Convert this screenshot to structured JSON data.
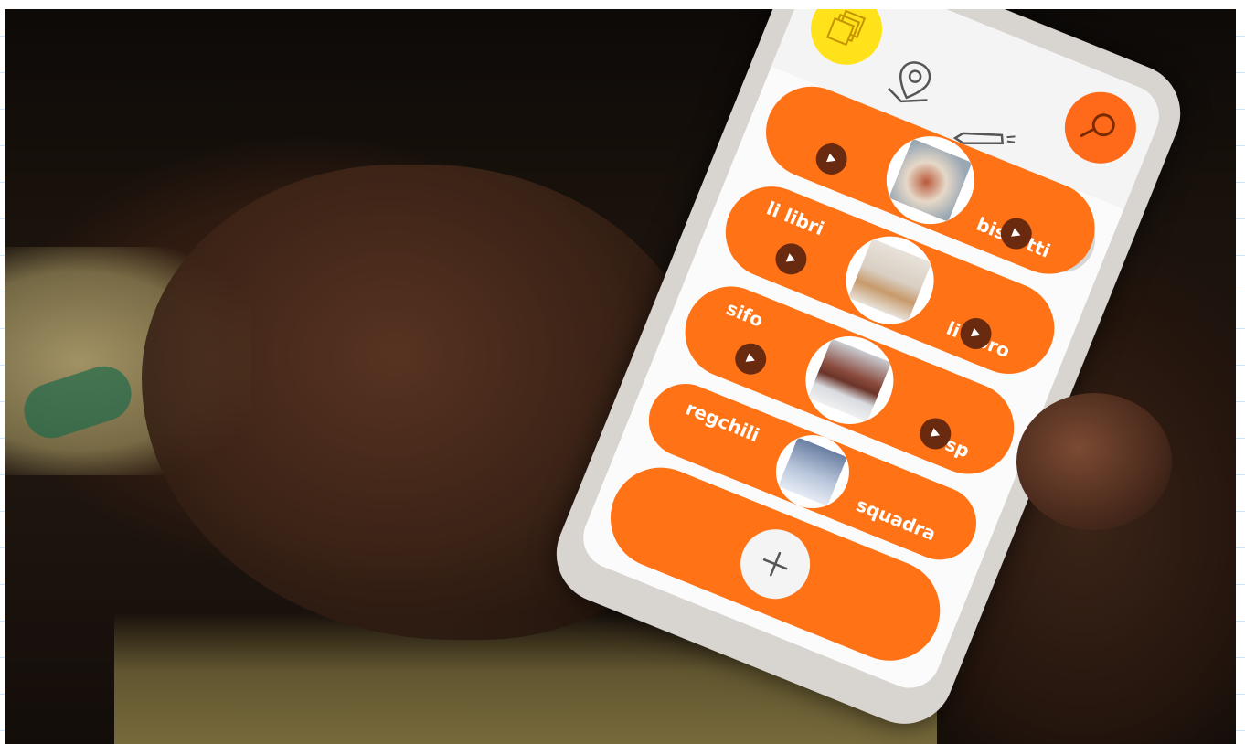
{
  "app": {
    "cards": [
      {
        "left_label": "",
        "right_label": "biscotti",
        "thumb": "biscuit-photo"
      },
      {
        "left_label": "li libri",
        "right_label": "li libro",
        "thumb": "book-photo"
      },
      {
        "left_label": "sifo",
        "right_label": "sp",
        "thumb": "box-photo"
      },
      {
        "left_label": "regchili",
        "right_label": "squadra",
        "thumb": "ruler-photo"
      }
    ],
    "add_label": "+"
  },
  "colors": {
    "accent": "#ff7316",
    "yellow": "#ffe21a",
    "search": "#ff6a1a",
    "play": "#6a2a10"
  },
  "icons": {
    "cards": "cards-stack-icon",
    "location": "location-pin-icon",
    "edit": "pencil-icon",
    "search": "search-icon",
    "settings": "gear-icon",
    "play": "play-icon",
    "add": "plus-icon"
  }
}
